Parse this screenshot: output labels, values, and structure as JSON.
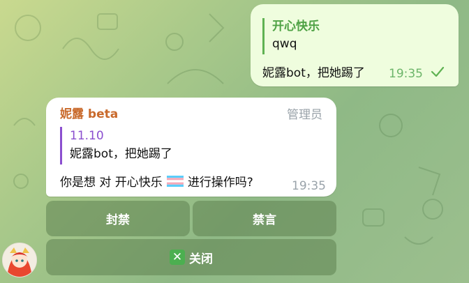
{
  "outgoing": {
    "reply_name": "开心快乐",
    "reply_text": "qwq",
    "text": "妮露bot，把她踢了",
    "time": "19:35",
    "status_icon": "check-icon"
  },
  "incoming": {
    "sender": "妮露 beta",
    "role": "管理员",
    "reply_name": "11.10",
    "reply_text": "妮露bot，把她踢了",
    "text_before": "你是想 对 开心快乐",
    "text_after": "进行操作吗?",
    "time": "19:35",
    "flag_icon": "transgender-flag-icon"
  },
  "keyboard": {
    "ban": "封禁",
    "mute": "禁言",
    "close": "关闭",
    "close_icon": "cross-mark-icon"
  },
  "colors": {
    "outgoing_bubble": "#effdde",
    "incoming_bubble": "#ffffff",
    "sender_name": "#c96a2c",
    "outgoing_quote": "#4fa245",
    "incoming_quote": "#8b4fcf"
  }
}
